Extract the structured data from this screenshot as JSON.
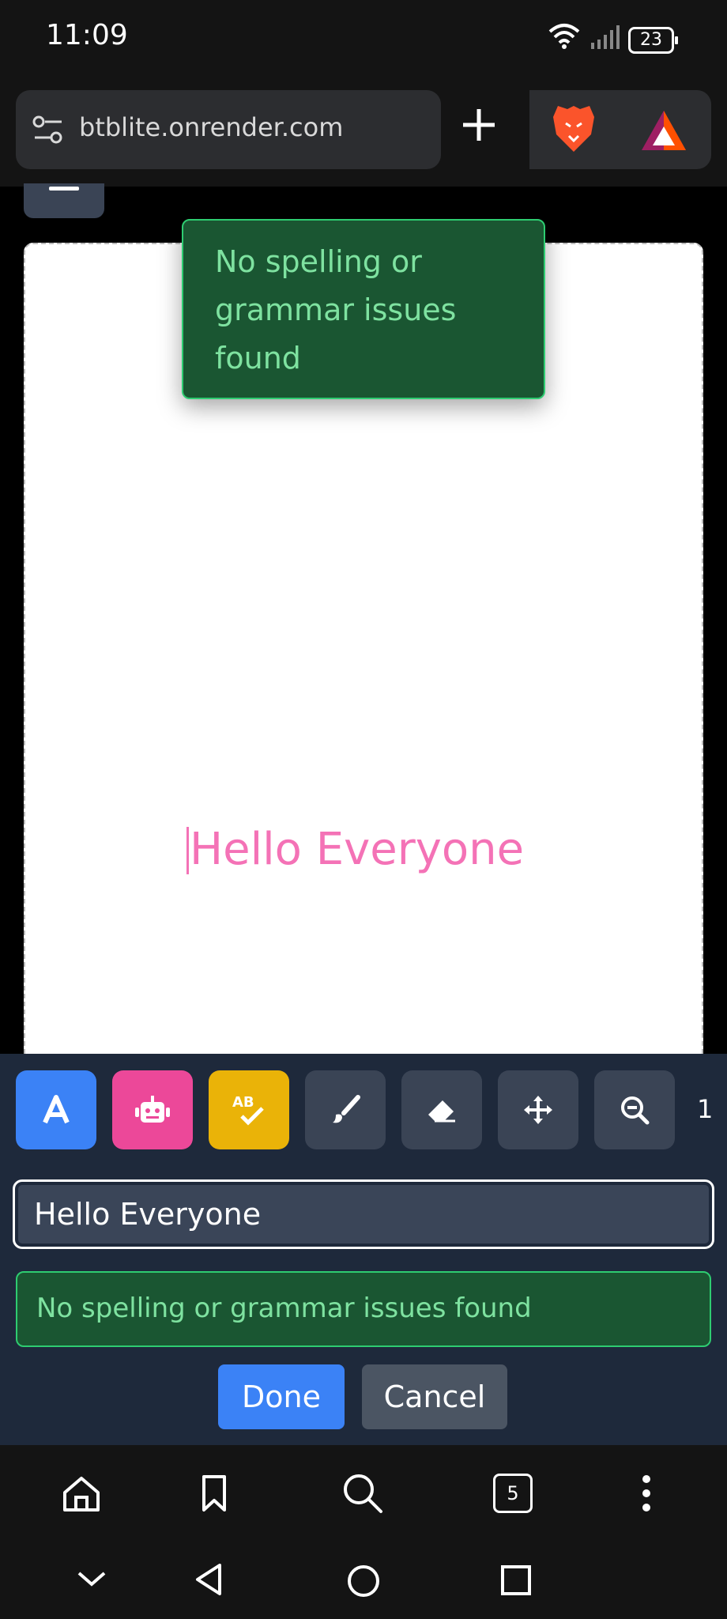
{
  "status_bar": {
    "time": "11:09",
    "battery": "23",
    "icons": [
      "wifi-icon",
      "signal-icon",
      "battery-icon"
    ]
  },
  "browser": {
    "url": "btblite.onrender.com",
    "new_tab_icon": "plus-icon",
    "brand_icons": [
      "brave-lion-icon",
      "bat-triangle-icon"
    ]
  },
  "canvas": {
    "toast_message": "No spelling or grammar issues found",
    "text": "Hello Everyone",
    "text_color": "#f472b6"
  },
  "toolbar": {
    "tools": [
      {
        "name": "text-tool",
        "icon": "letter-a-icon",
        "color": "#3b82f6"
      },
      {
        "name": "ai-tool",
        "icon": "robot-icon",
        "color": "#ec4899"
      },
      {
        "name": "spellcheck-tool",
        "icon": "spellcheck-icon",
        "color": "#eab308"
      },
      {
        "name": "brush-tool",
        "icon": "brush-icon",
        "color": "#3a4455"
      },
      {
        "name": "eraser-tool",
        "icon": "eraser-icon",
        "color": "#3a4455"
      },
      {
        "name": "move-tool",
        "icon": "move-icon",
        "color": "#3a4455"
      },
      {
        "name": "zoom-out-tool",
        "icon": "zoom-out-icon",
        "color": "#3a4455"
      }
    ],
    "overflow_label": "1"
  },
  "editor": {
    "input_value": "Hello Everyone",
    "status_message": "No spelling or grammar issues found",
    "done_label": "Done",
    "cancel_label": "Cancel"
  },
  "bottom_nav": {
    "tab_count": "5",
    "items": [
      "home-icon",
      "bookmark-icon",
      "search-icon",
      "tabs-icon",
      "more-icon"
    ]
  },
  "system_nav": [
    "chevron-down-icon",
    "back-icon",
    "home-circle-icon",
    "recents-icon"
  ]
}
